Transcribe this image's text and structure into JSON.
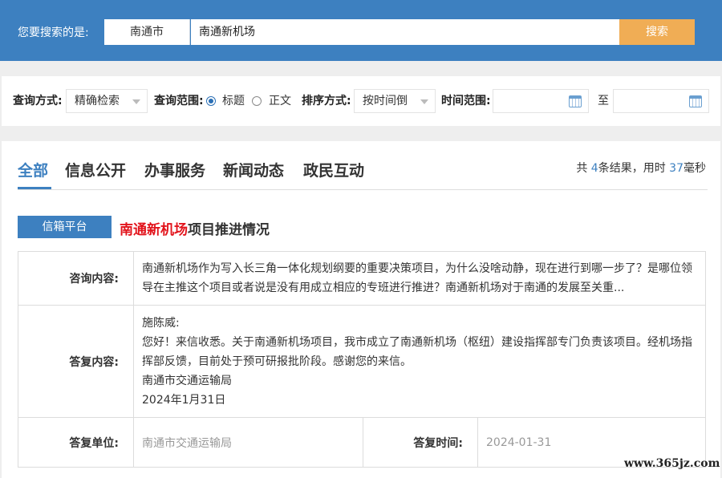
{
  "search": {
    "label": "您要搜索的是:",
    "city": "南通市",
    "query": "南通新机场",
    "button": "搜索"
  },
  "filters": {
    "mode_label": "查询方式:",
    "mode_value": "精确检索",
    "scope_label": "查询范围:",
    "scope_title": "标题",
    "scope_body": "正文",
    "scope_selected": "标题",
    "sort_label": "排序方式:",
    "sort_value": "按时间倒",
    "time_label": "时间范围:",
    "time_to": "至",
    "date_from": "",
    "date_to": ""
  },
  "tabs": [
    "全部",
    "信息公开",
    "办事服务",
    "新闻动态",
    "政民互动"
  ],
  "stats": {
    "prefix": "共 ",
    "count": "4",
    "mid": "条结果，用时 ",
    "ms": "37",
    "suffix": "毫秒"
  },
  "result": {
    "badge": "信箱平台",
    "title_highlight": "南通新机场",
    "title_rest": "项目推进情况",
    "consult_label": "咨询内容:",
    "consult_text": "南通新机场作为写入长三角一体化规划纲要的重要决策项目，为什么没啥动静，现在进行到哪一步了？是哪位领导在主推这个项目或者说是没有用成立相应的专班进行推进？南通新机场对于南通的发展至关重...",
    "reply_label": "答复内容:",
    "reply_lines": [
      "施陈威:",
      "您好！来信收悉。关于南通新机场项目，我市成立了南通新机场（枢纽）建设指挥部专门负责该项目。经机场指挥部反馈，目前处于预可研报批阶段。感谢您的来信。",
      "南通市交通运输局",
      "2024年1月31日"
    ],
    "unit_label": "答复单位:",
    "unit_value": "南通市交通运输局",
    "time_label": "答复时间:",
    "time_value": "2024-01-31"
  },
  "watermark": "www.365jz.com",
  "colors": {
    "primary": "#3d80c0",
    "search_button": "#f0ad55",
    "highlight": "#e2141c"
  }
}
